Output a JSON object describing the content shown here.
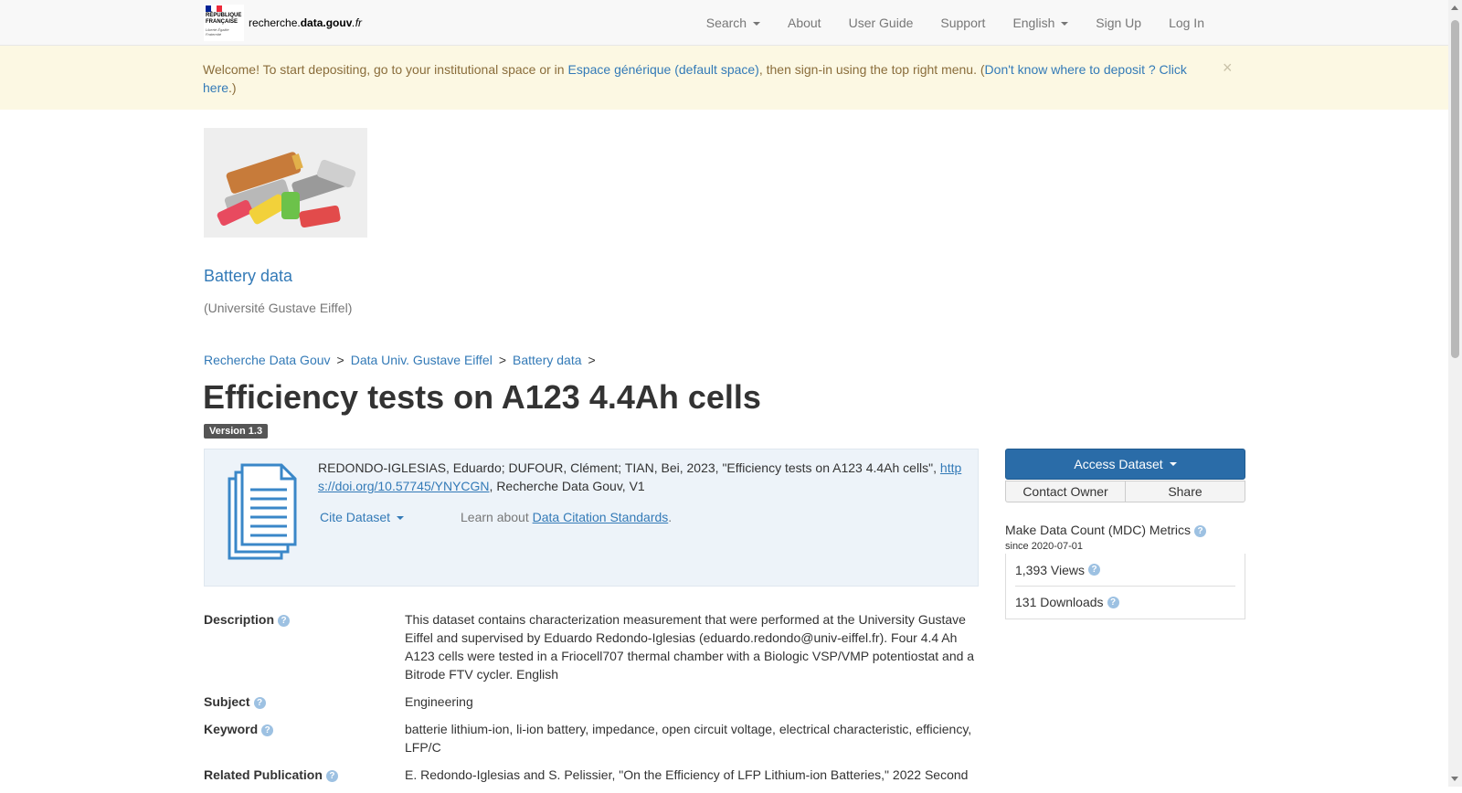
{
  "brand": {
    "republic_line1": "RÉPUBLIQUE",
    "republic_line2": "FRANÇAISE",
    "motto": "Liberté Égalité Fraternité",
    "site_prefix": "recherche.",
    "site_bold": "data.gouv",
    "site_suffix": ".fr"
  },
  "nav": {
    "search": "Search",
    "about": "About",
    "user_guide": "User Guide",
    "support": "Support",
    "language": "English",
    "sign_up": "Sign Up",
    "log_in": "Log In"
  },
  "alert": {
    "text1": "Welcome! To start depositing, go to your institutional space or in ",
    "link1": "Espace générique (default space)",
    "text2": ", then sign-in using the top right menu. (",
    "link2": "Don't know where to deposit ? Click here",
    "text3": ".)",
    "close": "×"
  },
  "dataverse": {
    "name": "Battery data",
    "affiliation": "(Université Gustave Eiffel)"
  },
  "breadcrumb": [
    {
      "label": "Recherche Data Gouv"
    },
    {
      "label": "Data Univ. Gustave Eiffel"
    },
    {
      "label": "Battery data"
    }
  ],
  "breadcrumb_sep": ">",
  "dataset": {
    "title": "Efficiency tests on A123 4.4Ah cells",
    "version": "Version 1.3"
  },
  "citation": {
    "text_before": "REDONDO-IGLESIAS, Eduardo; DUFOUR, Clément; TIAN, Bei, 2023, \"Efficiency tests on A123 4.4Ah cells\", ",
    "doi": "https://doi.org/10.57745/YNYCGN",
    "text_after": ", Recherche Data Gouv, V1",
    "cite_button": "Cite Dataset",
    "learn_prefix": "Learn about ",
    "learn_link": "Data Citation Standards",
    "learn_suffix": "."
  },
  "metadata": [
    {
      "label": "Description",
      "value": "This dataset contains characterization measurement that were performed at the University Gustave Eiffel and supervised by Eduardo Redondo-Iglesias (eduardo.redondo@univ-eiffel.fr). Four 4.4 Ah A123 cells were tested in a Friocell707 thermal chamber with a Biologic VSP/VMP potentiostat and a Bitrode FTV cycler. English"
    },
    {
      "label": "Subject",
      "value": "Engineering"
    },
    {
      "label": "Keyword",
      "value": "batterie lithium-ion, li-ion battery, impedance, open circuit voltage, electrical characteristic, efficiency, LFP/C"
    },
    {
      "label": "Related Publication",
      "value": "E. Redondo-Iglesias and S. Pelissier, \"On the Efficiency of LFP Lithium-ion Batteries,\" 2022 Second"
    }
  ],
  "sidebar": {
    "access_button": "Access Dataset",
    "contact_owner": "Contact Owner",
    "share": "Share",
    "mdc_title": "Make Data Count (MDC) Metrics",
    "mdc_since": "since 2020-07-01",
    "views": "1,393 Views",
    "downloads": "131 Downloads"
  },
  "icons": {
    "help": "?",
    "caret": "caret-down-icon",
    "citation": "document-stack-icon"
  },
  "colors": {
    "link": "#337ab7",
    "alert_bg": "#fcf8e3",
    "citation_bg": "#edf3f9",
    "primary_button": "#2a6ca8",
    "help_icon": "#9dc1e2"
  }
}
